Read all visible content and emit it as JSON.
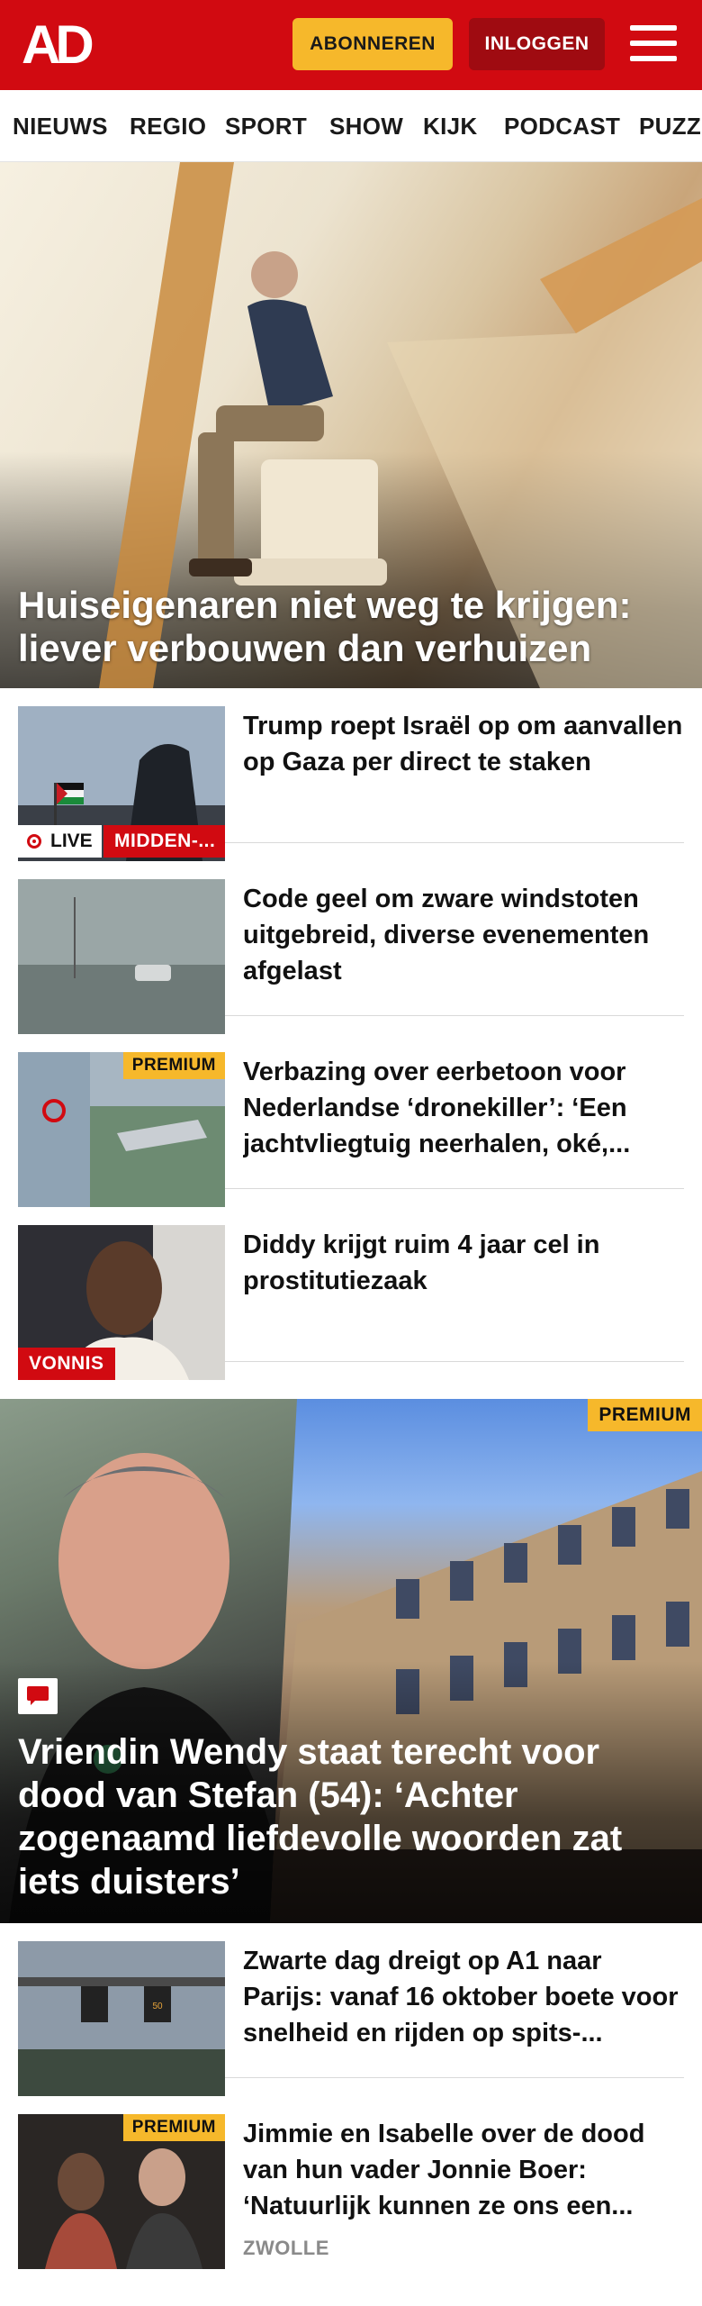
{
  "header": {
    "logo_text": "AD",
    "subscribe_label": "ABONNEREN",
    "login_label": "INLOGGEN",
    "menu_icon": "hamburger-menu-icon",
    "brand_color": "#d10a11",
    "accent_color": "#f6b82b"
  },
  "nav": {
    "items": [
      "NIEUWS",
      "REGIO",
      "SPORT",
      "SHOW",
      "KIJK",
      "PODCAST",
      "PUZZ"
    ]
  },
  "hero": {
    "title": "Huiseigenaren niet weg te krijgen: liever verbouwen dan verhuizen"
  },
  "articles": [
    {
      "title": "Trump roept Israël op om aanvallen op Gaza per direct te staken",
      "live_label": "LIVE",
      "category": "MIDDEN-..."
    },
    {
      "title": "Code geel om zware windstoten uitgebreid, diverse evenementen afgelast"
    },
    {
      "title": "Verbazing over eerbetoon voor Nederlandse ‘dronekiller’: ‘Een jachtvliegtuig neerhalen, oké,...",
      "premium_label": "PREMIUM"
    },
    {
      "title": "Diddy krijgt ruim 4 jaar cel in prostitutiezaak",
      "category": "VONNIS"
    }
  ],
  "feature": {
    "title": "Vriendin Wendy staat terecht voor dood van Stefan (54): ‘Achter zogenaamd liefdevolle woorden zat iets duisters’",
    "premium_label": "PREMIUM",
    "comment_icon": "comment-icon"
  },
  "articles2": [
    {
      "title": "Zwarte dag dreigt op A1 naar Parijs: vanaf 16 oktober boete voor snelheid en rijden op spits-..."
    },
    {
      "title": "Jimmie en Isabelle over de dood van hun vader Jonnie Boer: ‘Natuurlijk kunnen ze ons een...",
      "premium_label": "PREMIUM",
      "region": "ZWOLLE"
    }
  ]
}
